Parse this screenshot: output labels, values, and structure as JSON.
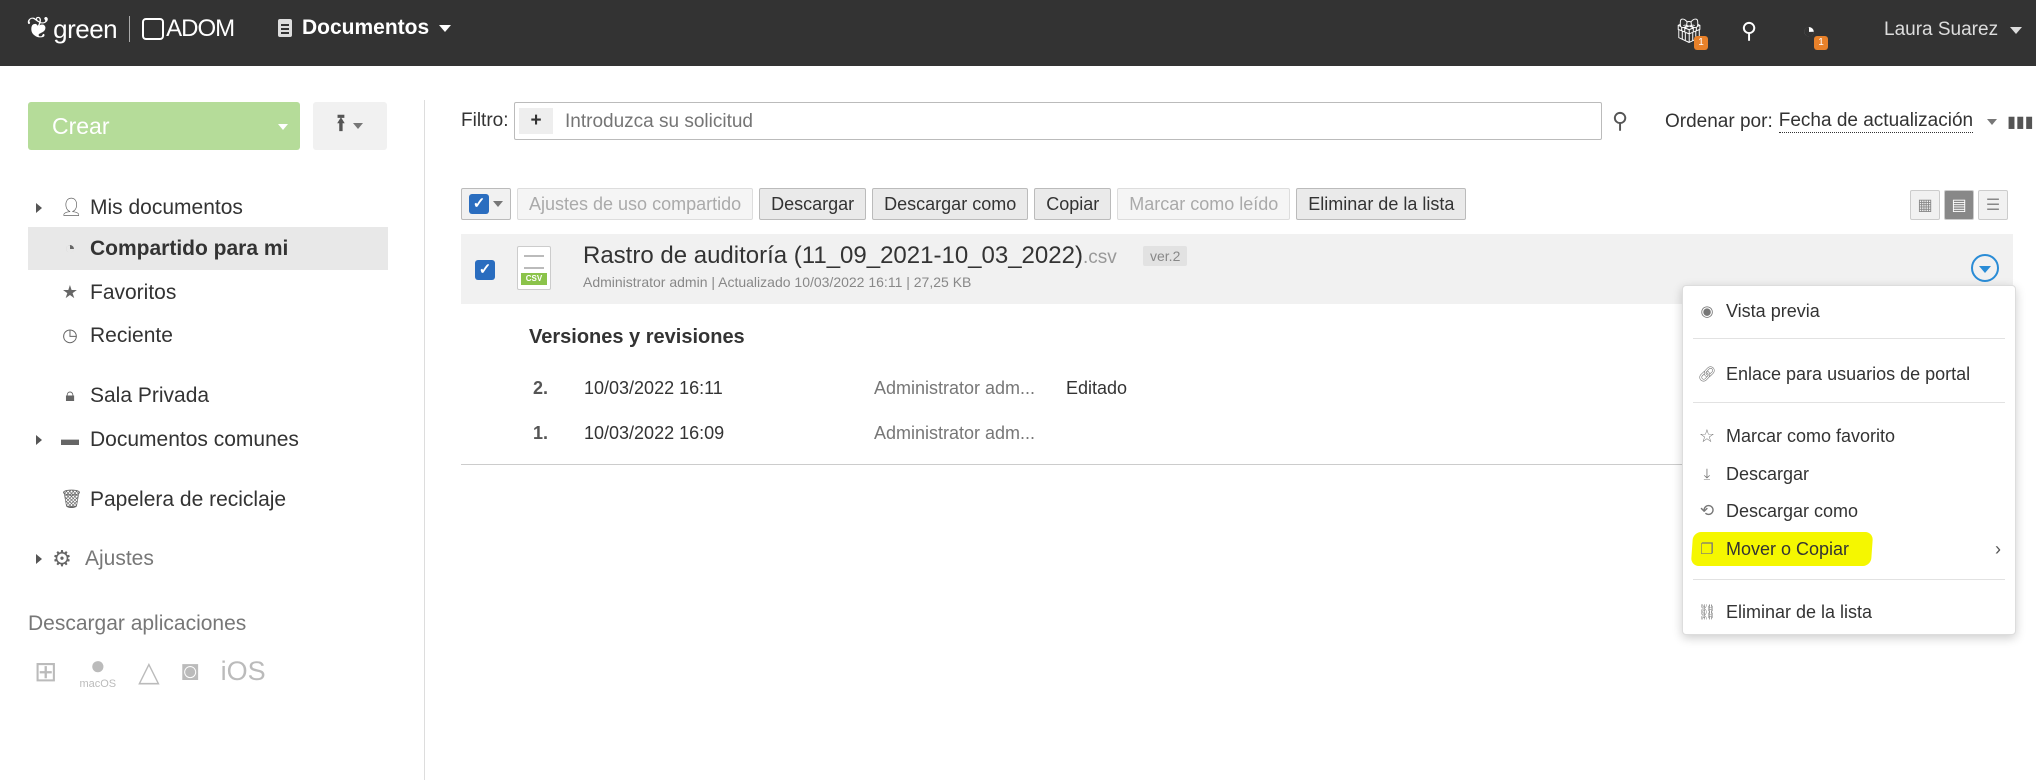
{
  "topbar": {
    "brand_left": "green",
    "brand_right": "ADOM",
    "module_title": "Documentos",
    "gift_badge": "1",
    "feed_badge": "1",
    "user_name": "Laura Suarez"
  },
  "sidebar": {
    "create_label": "Crear",
    "items": [
      {
        "label": "Mis documentos",
        "icon": "person-icon"
      },
      {
        "label": "Compartido para mi",
        "icon": "shared-icon"
      },
      {
        "label": "Favoritos",
        "icon": "star-icon"
      },
      {
        "label": "Reciente",
        "icon": "clock-icon"
      },
      {
        "label": "Sala Privada",
        "icon": "lock-icon"
      },
      {
        "label": "Documentos comunes",
        "icon": "briefcase-icon"
      },
      {
        "label": "Papelera de reciclaje",
        "icon": "trash-icon"
      },
      {
        "label": "Ajustes",
        "icon": "gear-icon"
      }
    ],
    "apps_title": "Descargar aplicaciones",
    "apps_macos": "macOS",
    "apps_ios": "iOS"
  },
  "filter": {
    "label": "Filtro:",
    "placeholder": "Introduzca su solicitud",
    "sort_label": "Ordenar por:",
    "sort_value": "Fecha de actualización"
  },
  "toolbar": {
    "sharing_settings": "Ajustes de uso compartido",
    "download": "Descargar",
    "download_as": "Descargar como",
    "copy": "Copiar",
    "mark_read": "Marcar como leído",
    "remove_from_list": "Eliminar de la lista"
  },
  "file": {
    "name": "Rastro de auditoría (11_09_2021-10_03_2022)",
    "ext": ".csv",
    "version": "ver.2",
    "meta": "Administrator admin | Actualizado 10/03/2022 16:11 | 27,25 KB",
    "icon_tag": "CSV"
  },
  "versions": {
    "title": "Versiones y revisiones",
    "rows": [
      {
        "num": "2.",
        "date": "10/03/2022 16:11",
        "author": "Administrator adm...",
        "note": "Editado"
      },
      {
        "num": "1.",
        "date": "10/03/2022 16:09",
        "author": "Administrator adm...",
        "note": ""
      }
    ]
  },
  "context_menu": {
    "items": [
      {
        "label": "Vista previa",
        "icon": "eye-icon"
      },
      {
        "label": "Enlace para usuarios de portal",
        "icon": "link-icon"
      },
      {
        "label": "Marcar como favorito",
        "icon": "star-outline-icon"
      },
      {
        "label": "Descargar",
        "icon": "download-icon"
      },
      {
        "label": "Descargar como",
        "icon": "download-as-icon"
      },
      {
        "label": "Mover o Copiar",
        "icon": "copy-icon"
      },
      {
        "label": "Eliminar de la lista",
        "icon": "unlink-icon"
      }
    ],
    "highlight_color": "#f5f700"
  },
  "colors": {
    "topbar": "#333333",
    "create_button": "#b5dc99",
    "accent_blue": "#2a8cd6",
    "badge": "#e8812a"
  }
}
